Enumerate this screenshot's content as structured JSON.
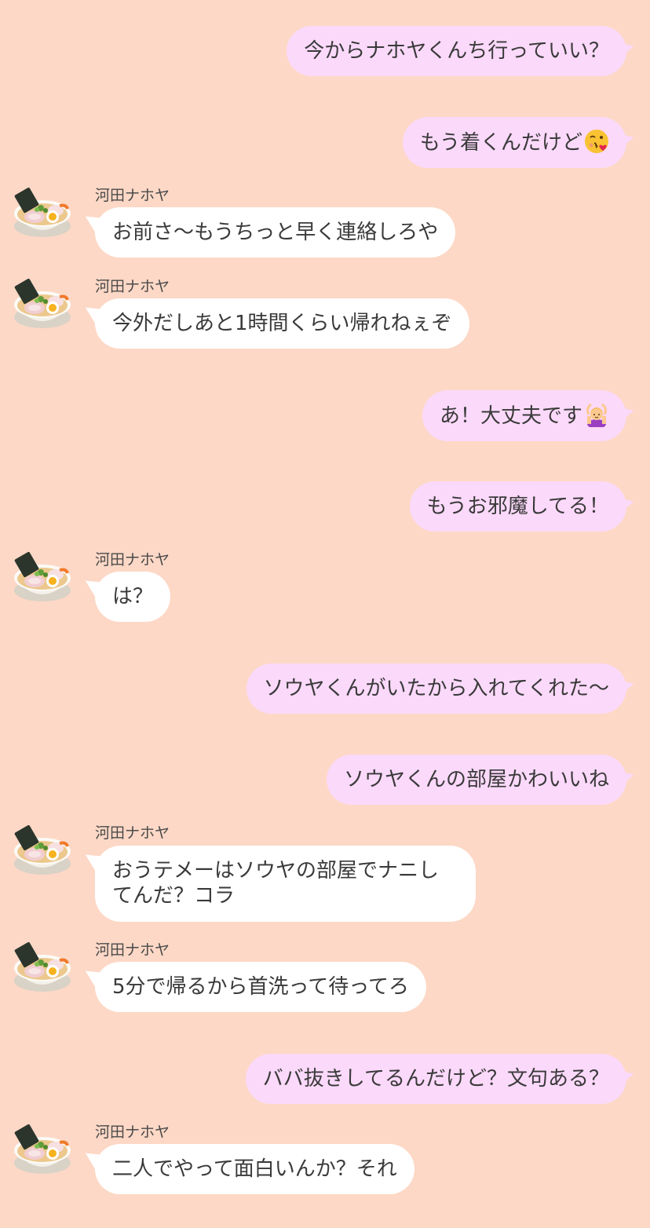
{
  "contact": {
    "name": "河田ナホヤ"
  },
  "messages": [
    {
      "side": "out",
      "text": "今からナホヤくんち行っていい？"
    },
    {
      "side": "out",
      "text": "もう着くんだけど",
      "emoji": "kissing-face-emoji"
    },
    {
      "side": "in",
      "sender": "河田ナホヤ",
      "text": "お前さ〜もうちっと早く連絡しろや"
    },
    {
      "side": "in",
      "sender": "河田ナホヤ",
      "text": "今外だしあと1時間くらい帰れねぇぞ"
    },
    {
      "side": "out",
      "text": "あ！大丈夫です",
      "emoji": "person-gesturing-ok-emoji"
    },
    {
      "side": "out",
      "text": "もうお邪魔してる！"
    },
    {
      "side": "in",
      "sender": "河田ナホヤ",
      "text": "は？"
    },
    {
      "side": "out",
      "text": "ソウヤくんがいたから入れてくれた〜"
    },
    {
      "side": "out",
      "text": "ソウヤくんの部屋かわいいね"
    },
    {
      "side": "in",
      "sender": "河田ナホヤ",
      "text": "おうテメーはソウヤの部屋でナニしてんだ？コラ"
    },
    {
      "side": "in",
      "sender": "河田ナホヤ",
      "text": "5分で帰るから首洗って待ってろ"
    },
    {
      "side": "out",
      "text": "ババ抜きしてるんだけど？文句ある？"
    },
    {
      "side": "in",
      "sender": "河田ナホヤ",
      "text": "二人でやって面白いんか？それ"
    }
  ],
  "avatar_icon": "ramen-bowl-icon",
  "colors": {
    "background": "#fdd8c6",
    "outgoing_bubble": "#fbd9fa",
    "incoming_bubble": "#ffffff"
  }
}
